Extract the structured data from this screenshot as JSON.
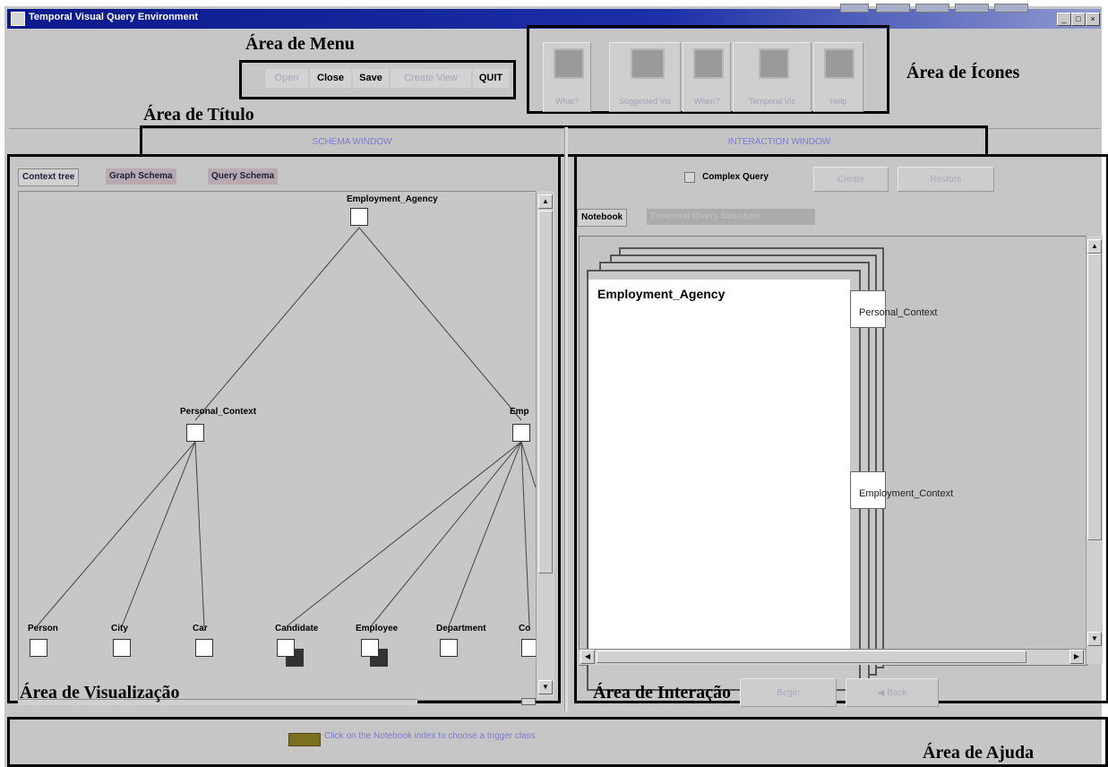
{
  "window": {
    "title": "Temporal Visual Query Environment"
  },
  "annotations": {
    "menu_area": "Área de Menu",
    "icons_area": "Área de Ícones",
    "title_area": "Área de Título",
    "visualization_area": "Área de Visualização",
    "interaction_area": "Área de Interação",
    "help_area": "Área de Ajuda"
  },
  "menu": {
    "open": "Open",
    "close": "Close",
    "save": "Save",
    "create_view": "Create View",
    "quit": "QUIT"
  },
  "icons": {
    "what": "What?",
    "suggested_vis": "Suggested Vis",
    "when": "When?",
    "temporal_vis": "Temporal Vis",
    "help": "Help"
  },
  "panels": {
    "schema_window": "SCHEMA WINDOW",
    "interaction_window": "INTERACTION WINDOW"
  },
  "schema_tabs": [
    "Context tree",
    "Graph Schema",
    "Query Schema"
  ],
  "tree": {
    "root": "Employment_Agency",
    "personal": "Personal_Context",
    "employment_cut": "Emp",
    "leaves": [
      "Person",
      "City",
      "Car",
      "Candidate",
      "Employee",
      "Department",
      "Co"
    ]
  },
  "interaction": {
    "complex_query": "Complex Query",
    "create_button": "Create",
    "restore_button": "Restore",
    "notebook_tab": "Notebook",
    "second_tab": "Temporal Query Structure",
    "page_title": "Employment_Agency",
    "side_tabs": [
      "Personal_Context",
      "Employment_Context"
    ],
    "begin_button": "Begin",
    "back_button": "Back"
  },
  "help": {
    "message": "Click on the Notebook index to choose a trigger class"
  }
}
